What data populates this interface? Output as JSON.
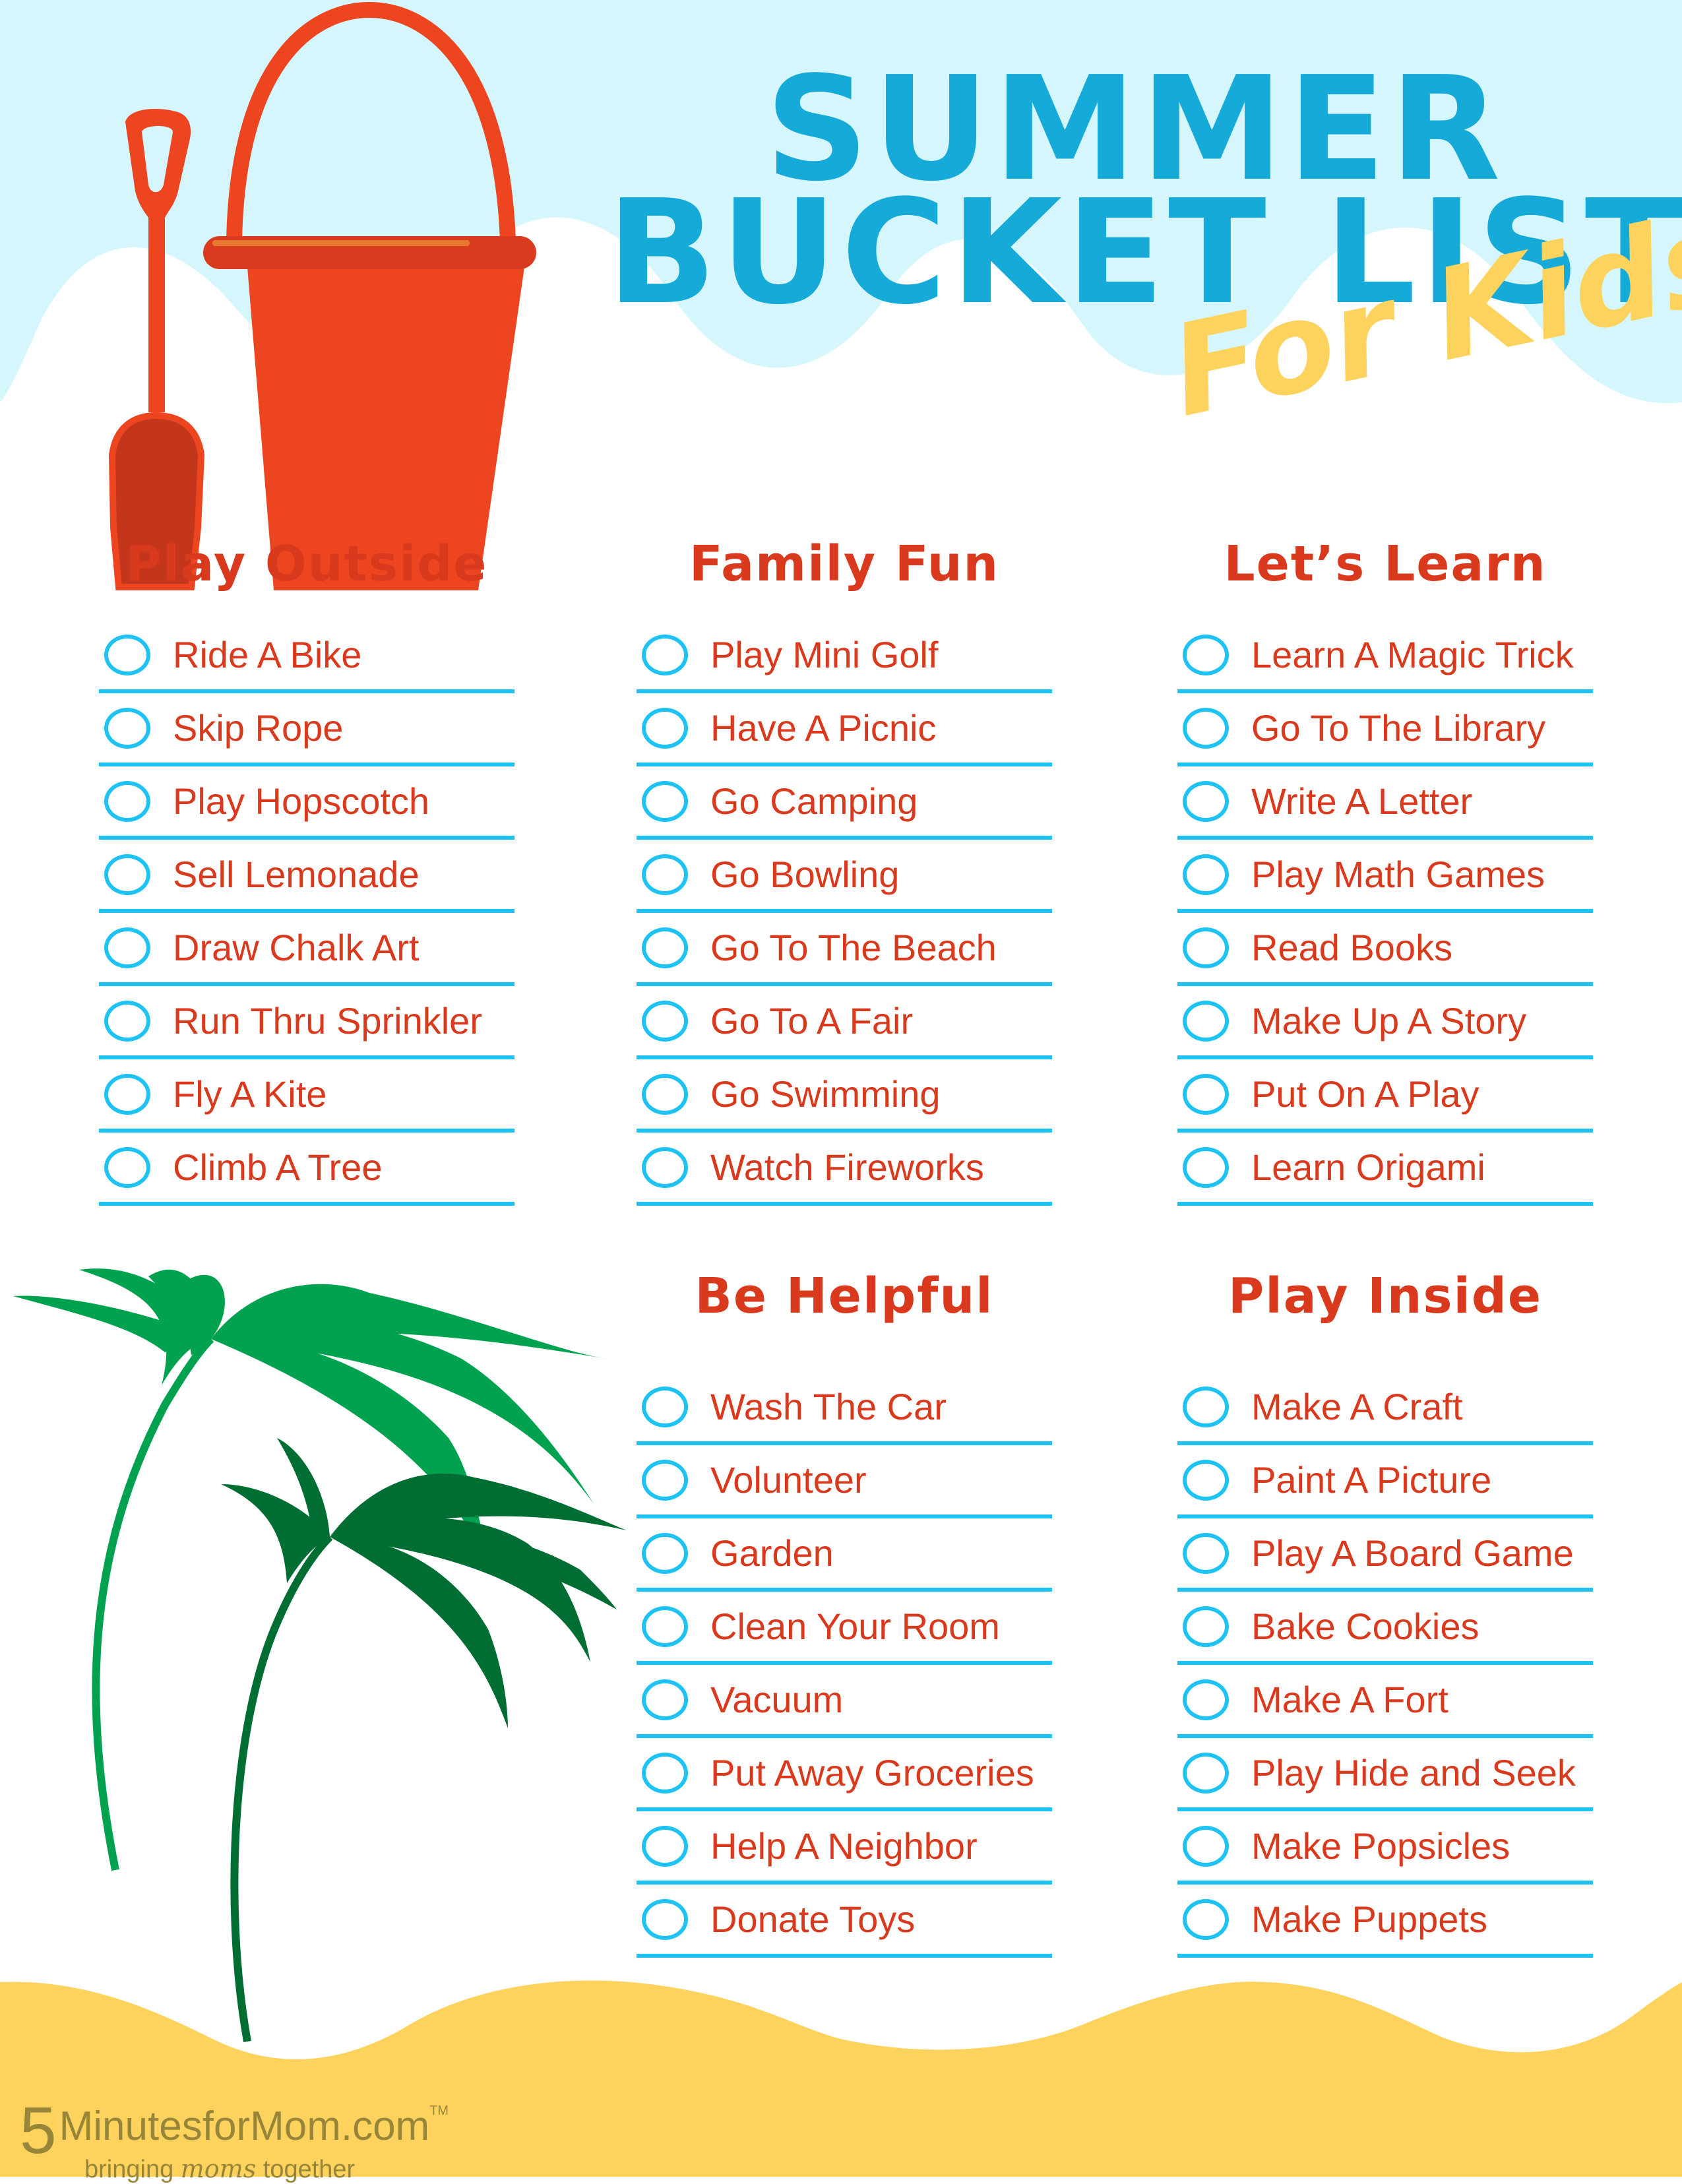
{
  "header": {
    "title_line_1": "SUMMER",
    "title_line_2": "BUCKET LIST",
    "subtitle": "For Kids"
  },
  "colors": {
    "sky": "#d5f6fd",
    "title_blue": "#15aad8",
    "accent_red": "#d93a1e",
    "checkbox_blue": "#1ec3f3",
    "sand": "#fed35d",
    "palm_light": "#00a250",
    "palm_dark": "#006d33",
    "bucket_red": "#ee4521"
  },
  "illustrations": {
    "top_left": [
      "shovel-icon",
      "bucket-icon"
    ],
    "bottom_left": "palm-tree-icon"
  },
  "sections": [
    {
      "title": "Play Outside",
      "items": [
        "Ride A Bike",
        "Skip Rope",
        "Play Hopscotch",
        "Sell Lemonade",
        "Draw Chalk Art",
        "Run Thru Sprinkler",
        "Fly A Kite",
        "Climb A Tree"
      ]
    },
    {
      "title": "Family Fun",
      "items": [
        "Play Mini Golf",
        "Have A Picnic",
        "Go Camping",
        "Go Bowling",
        "Go To The Beach",
        "Go To A Fair",
        "Go Swimming",
        "Watch Fireworks"
      ]
    },
    {
      "title": "Let’s Learn",
      "items": [
        "Learn A Magic Trick",
        "Go To The Library",
        "Write A Letter",
        "Play Math Games",
        "Read Books",
        "Make Up A Story",
        "Put On A Play",
        "Learn Origami"
      ]
    },
    {
      "title": "Be Helpful",
      "items": [
        "Wash The Car",
        "Volunteer",
        "Garden",
        "Clean Your Room",
        "Vacuum",
        "Put Away Groceries",
        "Help A Neighbor",
        "Donate Toys"
      ]
    },
    {
      "title": "Play Inside",
      "items": [
        "Make A Craft",
        "Paint A Picture",
        "Play A Board Game",
        "Bake Cookies",
        "Make A Fort",
        "Play Hide and Seek",
        "Make Popsicles",
        "Make Puppets"
      ]
    }
  ],
  "footer": {
    "logo_five": "5",
    "logo_bold": "Minutes",
    "logo_rest": "forMom.com",
    "logo_tm": "TM",
    "tagline_pre": "bringing ",
    "tagline_em": "moms",
    "tagline_post": " together"
  }
}
